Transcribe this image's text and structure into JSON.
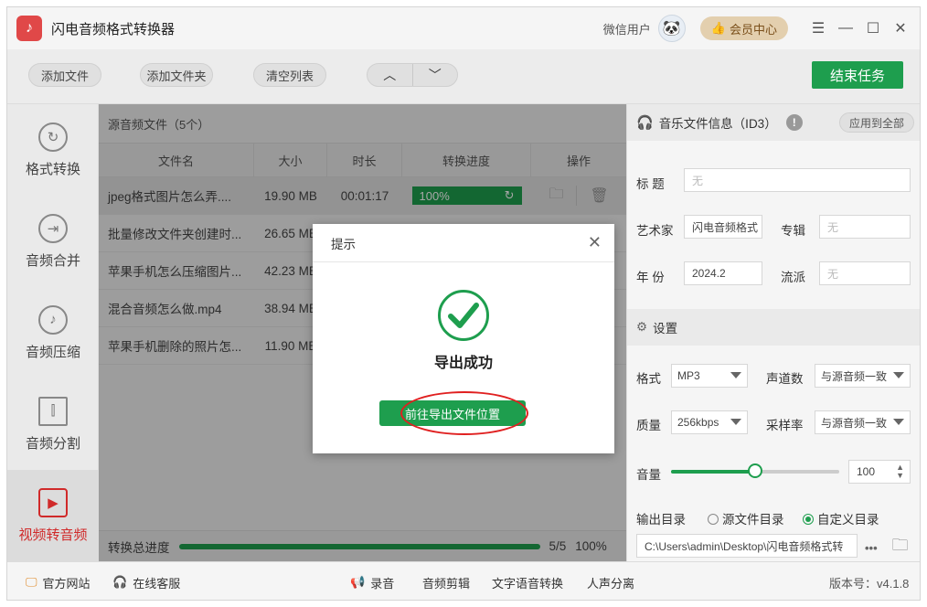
{
  "app": {
    "title": "闪电音频格式转换器",
    "logo_glyph": "♪"
  },
  "titlebar": {
    "user": "微信用户",
    "member": "会员中心",
    "controls": [
      "☰",
      "—",
      "☐",
      "✕"
    ]
  },
  "toolbar": {
    "add_file": "添加文件",
    "add_folder": "添加文件夹",
    "clear_list": "清空列表",
    "up": "︿",
    "down": "﹀",
    "end_task": "结束任务"
  },
  "sidebar": {
    "items": [
      {
        "label": "格式转换",
        "icon": "refresh-icon",
        "glyph": "↻"
      },
      {
        "label": "音频合并",
        "icon": "merge-icon",
        "glyph": "⇥"
      },
      {
        "label": "音频压缩",
        "icon": "note-icon",
        "glyph": "♪"
      },
      {
        "label": "音频分割",
        "icon": "split-icon",
        "glyph": "⫿"
      },
      {
        "label": "视频转音频",
        "icon": "video-play-icon",
        "glyph": "▶"
      }
    ]
  },
  "filelist": {
    "header": "源音频文件（5个）",
    "columns": [
      "文件名",
      "大小",
      "时长",
      "转换进度",
      "操作"
    ],
    "rows": [
      {
        "name": "jpeg格式图片怎么弄....",
        "size": "19.90 MB",
        "duration": "00:01:17",
        "progress": "100%"
      },
      {
        "name": "批量修改文件夹创建时...",
        "size": "26.65 MB"
      },
      {
        "name": "苹果手机怎么压缩图片...",
        "size": "42.23 MB"
      },
      {
        "name": "混合音频怎么做.mp4",
        "size": "38.94 MB"
      },
      {
        "name": "苹果手机删除的照片怎...",
        "size": "11.90 MB"
      }
    ],
    "total_label": "转换总进度",
    "total_count": "5/5",
    "total_percent": "100%"
  },
  "info": {
    "title": "音乐文件信息（ID3）",
    "apply_all": "应用到全部",
    "title_label": "标 题",
    "title_value": "无",
    "artist_label": "艺术家",
    "artist_value": "闪电音频格式",
    "album_label": "专辑",
    "album_value": "无",
    "year_label": "年 份",
    "year_value": "2024.2",
    "genre_label": "流派",
    "genre_value": "无"
  },
  "settings": {
    "title": "设置",
    "format_label": "格式",
    "format_value": "MP3",
    "channels_label": "声道数",
    "channels_value": "与源音频一致",
    "quality_label": "质量",
    "quality_value": "256kbps",
    "samplerate_label": "采样率",
    "samplerate_value": "与源音频一致",
    "volume_label": "音量",
    "volume_value": "100",
    "volume_fraction": 0.5,
    "output_label": "输出目录",
    "opt_source": "源文件目录",
    "opt_custom": "自定义目录",
    "output_path": "C:\\Users\\admin\\Desktop\\闪电音频格式转"
  },
  "footer": {
    "website": "官方网站",
    "service": "在线客服",
    "record": "录音",
    "edit": "音频剪辑",
    "tts": "文字语音转换",
    "separate": "人声分离",
    "version": "版本号：v4.1.8"
  },
  "modal": {
    "title": "提示",
    "message": "导出成功",
    "button": "前往导出文件位置"
  },
  "colors": {
    "accent": "#1e9e4e",
    "active": "#d02a2a",
    "annotation": "#e02020"
  }
}
